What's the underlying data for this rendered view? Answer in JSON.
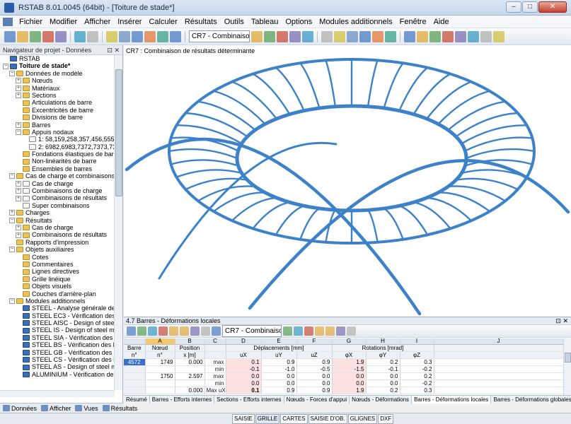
{
  "window": {
    "title": "RSTAB 8.01.0045 (64bit) - [Toiture de stade*]"
  },
  "menu": [
    "Fichier",
    "Modifier",
    "Afficher",
    "Insérer",
    "Calculer",
    "Résultats",
    "Outils",
    "Tableau",
    "Options",
    "Modules additionnels",
    "Fenêtre",
    "Aide"
  ],
  "toolbar": {
    "combo": "CR7 - Combinaison de rés"
  },
  "navigator": {
    "title": "Navigateur de projet - Données",
    "items": [
      {
        "label": "RSTAB",
        "lvl": 0,
        "icon": "app",
        "toggle": ""
      },
      {
        "label": "Toiture de stade*",
        "lvl": 0,
        "icon": "app",
        "toggle": "-",
        "bold": true
      },
      {
        "label": "Données de modèle",
        "lvl": 1,
        "icon": "fold",
        "toggle": "-"
      },
      {
        "label": "Nœuds",
        "lvl": 2,
        "icon": "fold",
        "toggle": "+"
      },
      {
        "label": "Matériaux",
        "lvl": 2,
        "icon": "fold",
        "toggle": "+"
      },
      {
        "label": "Sections",
        "lvl": 2,
        "icon": "fold",
        "toggle": "+"
      },
      {
        "label": "Articulations de barre",
        "lvl": 2,
        "icon": "fold",
        "toggle": ""
      },
      {
        "label": "Excentricités de barre",
        "lvl": 2,
        "icon": "fold",
        "toggle": ""
      },
      {
        "label": "Divisions de barre",
        "lvl": 2,
        "icon": "fold",
        "toggle": ""
      },
      {
        "label": "Barres",
        "lvl": 2,
        "icon": "fold",
        "toggle": "+"
      },
      {
        "label": "Appuis nodaux",
        "lvl": 2,
        "icon": "fold",
        "toggle": "-"
      },
      {
        "label": "1: 58,159,258,357,456,555,653,",
        "lvl": 3,
        "icon": "doc",
        "toggle": ""
      },
      {
        "label": "2: 6982,6983,7372,7373,7384,7",
        "lvl": 3,
        "icon": "doc",
        "toggle": ""
      },
      {
        "label": "Fondations élastiques de barre",
        "lvl": 2,
        "icon": "fold",
        "toggle": ""
      },
      {
        "label": "Non-linéarités de barre",
        "lvl": 2,
        "icon": "fold",
        "toggle": ""
      },
      {
        "label": "Ensembles de barres",
        "lvl": 2,
        "icon": "fold",
        "toggle": ""
      },
      {
        "label": "Cas de charge et combinaisons",
        "lvl": 1,
        "icon": "fold",
        "toggle": "-"
      },
      {
        "label": "Cas de charge",
        "lvl": 2,
        "icon": "doc",
        "toggle": "+"
      },
      {
        "label": "Combinaisons de charge",
        "lvl": 2,
        "icon": "doc",
        "toggle": "+"
      },
      {
        "label": "Combinaisons de résultats",
        "lvl": 2,
        "icon": "doc",
        "toggle": "+"
      },
      {
        "label": "Super combinaisons",
        "lvl": 2,
        "icon": "doc",
        "toggle": ""
      },
      {
        "label": "Charges",
        "lvl": 1,
        "icon": "fold",
        "toggle": "+"
      },
      {
        "label": "Résultats",
        "lvl": 1,
        "icon": "fold",
        "toggle": "-"
      },
      {
        "label": "Cas de charge",
        "lvl": 2,
        "icon": "fold",
        "toggle": "+"
      },
      {
        "label": "Combinaisons de résultats",
        "lvl": 2,
        "icon": "fold",
        "toggle": "+"
      },
      {
        "label": "Rapports d'impression",
        "lvl": 1,
        "icon": "fold",
        "toggle": ""
      },
      {
        "label": "Objets auxiliaires",
        "lvl": 1,
        "icon": "fold",
        "toggle": "-"
      },
      {
        "label": "Cotes",
        "lvl": 2,
        "icon": "fold",
        "toggle": ""
      },
      {
        "label": "Commentaires",
        "lvl": 2,
        "icon": "fold",
        "toggle": ""
      },
      {
        "label": "Lignes directives",
        "lvl": 2,
        "icon": "fold",
        "toggle": ""
      },
      {
        "label": "Grille linéique",
        "lvl": 2,
        "icon": "fold",
        "toggle": ""
      },
      {
        "label": "Objets visuels",
        "lvl": 2,
        "icon": "fold",
        "toggle": ""
      },
      {
        "label": "Couches d'arrière-plan",
        "lvl": 2,
        "icon": "fold",
        "toggle": ""
      },
      {
        "label": "Modules additionnels",
        "lvl": 1,
        "icon": "fold",
        "toggle": "-"
      },
      {
        "label": "STEEL - Analyse générale de con",
        "lvl": 2,
        "icon": "app",
        "toggle": ""
      },
      {
        "label": "STEEL EC3 - Vérification des barr",
        "lvl": 2,
        "icon": "app",
        "toggle": ""
      },
      {
        "label": "STEEL AISC - Design of steel mem",
        "lvl": 2,
        "icon": "app",
        "toggle": ""
      },
      {
        "label": "STEEL IS - Design of steel membe",
        "lvl": 2,
        "icon": "app",
        "toggle": ""
      },
      {
        "label": "STEEL SIA - Vérification des barre",
        "lvl": 2,
        "icon": "app",
        "toggle": ""
      },
      {
        "label": "STEEL BS - Vérification des barres",
        "lvl": 2,
        "icon": "app",
        "toggle": ""
      },
      {
        "label": "STEEL GB - Vérification des barre",
        "lvl": 2,
        "icon": "app",
        "toggle": ""
      },
      {
        "label": "STEEL CS - Vérification des barre",
        "lvl": 2,
        "icon": "app",
        "toggle": ""
      },
      {
        "label": "STEEL AS - Design of steel memb",
        "lvl": 2,
        "icon": "app",
        "toggle": ""
      },
      {
        "label": "ALUMINIUM - Vérification des b",
        "lvl": 2,
        "icon": "app",
        "toggle": ""
      }
    ],
    "tabs": [
      "Données",
      "Afficher",
      "Vues",
      "Résultats"
    ]
  },
  "view": {
    "label": "CR7 : Combinaison de résultats déterminante"
  },
  "panel": {
    "title": "4.7 Barres - Déformations locales",
    "combo": "CR7 - Combinaison de",
    "col_letters": [
      "A",
      "B",
      "C",
      "D",
      "E",
      "F",
      "G",
      "H",
      "I",
      "J"
    ],
    "hdr1": [
      "Barre",
      "Nœud",
      "Position",
      "",
      "Déplacements [mm]",
      "Rotations [mrad]"
    ],
    "hdr2": [
      "n°",
      "n°",
      "x [m]",
      "",
      "uX",
      "uY",
      "uZ",
      "φX",
      "φY",
      "φZ"
    ],
    "rows": [
      [
        "4572",
        "1749",
        "0.000",
        "max",
        "0.1",
        "0.9",
        "0.9",
        "1.9",
        "0.2",
        "0.3"
      ],
      [
        "",
        "",
        "",
        "min",
        "-0.1",
        "-1.0",
        "-0.5",
        "-1.5",
        "-0.1",
        "-0.2"
      ],
      [
        "",
        "1750",
        "2.597",
        "max",
        "0.0",
        "0.0",
        "0.0",
        "0.0",
        "0.0",
        "0.2"
      ],
      [
        "",
        "",
        "",
        "min",
        "0.0",
        "0.0",
        "0.0",
        "0.0",
        "0.0",
        "-0.2"
      ],
      [
        "",
        "",
        "0.000",
        "Max uX",
        "0.1",
        "0.9",
        "0.9",
        "1.9",
        "0.2",
        "0.3"
      ]
    ],
    "tabs": [
      "Résumé",
      "Barres - Efforts internes",
      "Sections - Efforts internes",
      "Nœuds - Forces d'appui",
      "Nœuds - Déformations",
      "Barres - Déformations locales",
      "Barres - Déformations globales",
      "Élancements de barre"
    ]
  },
  "status": [
    "SAISIE",
    "GRILLE",
    "CARTES",
    "SAISIE D'OB.",
    "GLIGNES",
    "DXF"
  ]
}
